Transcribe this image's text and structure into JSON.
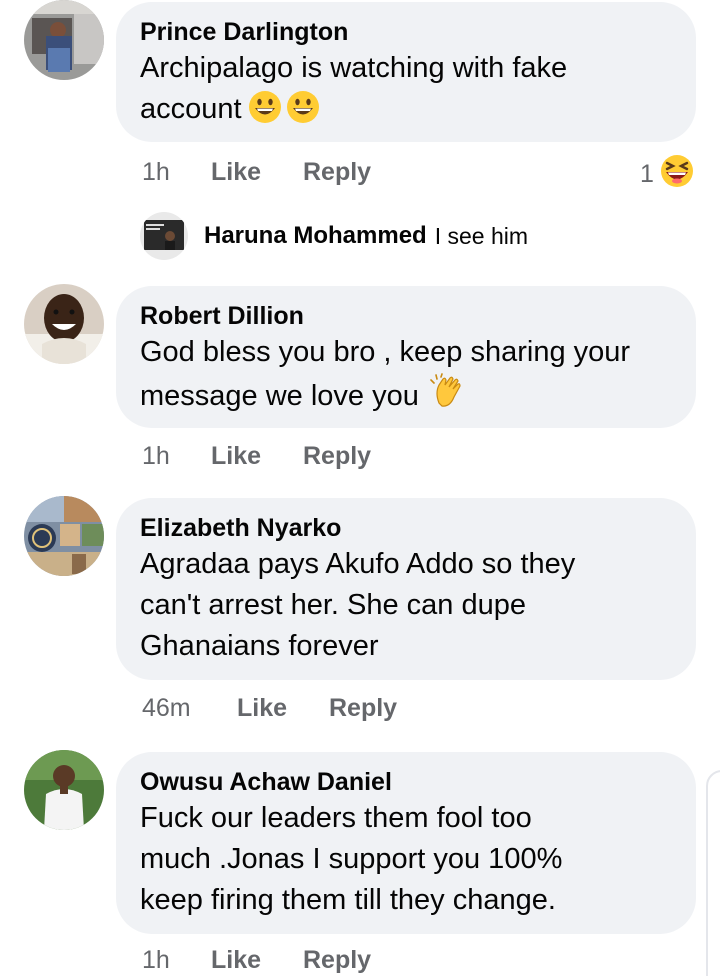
{
  "comments": [
    {
      "author": "Prince Darlington",
      "text_line1": "Archipalago is watching with fake",
      "text_line2": "account",
      "emojis": [
        "grinning-face",
        "grinning-face"
      ],
      "time": "1h",
      "like_label": "Like",
      "reply_label": "Reply",
      "reaction_count": "1",
      "reaction_icon": "laughing-squint-face"
    },
    {
      "author": "Robert Dillion",
      "text_line1": "God bless you bro , keep sharing your",
      "text_line2": "message we love you",
      "emojis": [
        "clapping-hands"
      ],
      "time": "1h",
      "like_label": "Like",
      "reply_label": "Reply"
    },
    {
      "author": "Elizabeth Nyarko",
      "text_line1": "Agradaa pays Akufo Addo so they",
      "text_line2": "can't arrest her. She can dupe",
      "text_line3": "Ghanaians forever",
      "time": "46m",
      "like_label": "Like",
      "reply_label": "Reply"
    },
    {
      "author": "Owusu Achaw Daniel",
      "text_line1": "Fuck our leaders them fool too",
      "text_line2": "much .Jonas I support you 100%",
      "text_line3": "keep firing them till they change.",
      "time": "1h",
      "like_label": "Like",
      "reply_label": "Reply"
    }
  ],
  "reply_preview": {
    "author": "Haruna Mohammed",
    "text": "I see him"
  },
  "colors": {
    "bubble": "#f0f2f5",
    "meta_text": "#65676b",
    "text": "#050505"
  }
}
